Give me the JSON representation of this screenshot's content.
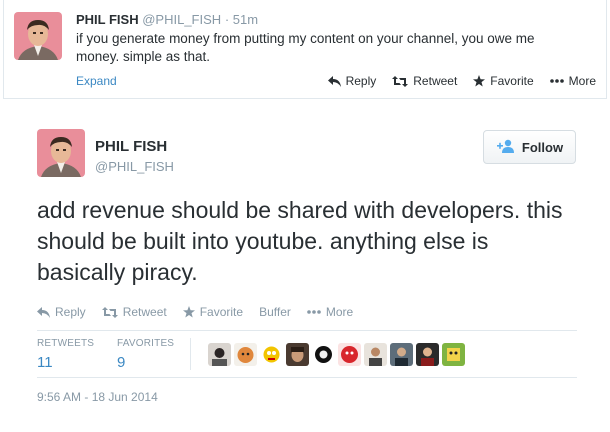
{
  "tweet_preview": {
    "name": "PHIL FISH",
    "handle": "@PHIL_FISH",
    "separator": "·",
    "time": "51m",
    "text": "if you generate money from putting my content on your channel, you owe me money. simple as that.",
    "expand_label": "Expand",
    "actions": {
      "reply": "Reply",
      "retweet": "Retweet",
      "favorite": "Favorite",
      "more": "More"
    }
  },
  "tweet_permalink": {
    "name": "PHIL FISH",
    "handle": "@PHIL_FISH",
    "follow_label": "Follow",
    "text": "add revenue should be shared with developers. this should be built into youtube. anything else is basically piracy.",
    "actions": {
      "reply": "Reply",
      "retweet": "Retweet",
      "favorite": "Favorite",
      "buffer": "Buffer",
      "more": "More"
    },
    "stats": {
      "retweets_label": "RETWEETS",
      "retweets_count": "11",
      "favorites_label": "FAVORITES",
      "favorites_count": "9"
    },
    "timestamp": "9:56 AM - 18 Jun 2014"
  },
  "colors": {
    "link_blue": "#3b88c3",
    "muted_gray": "#8899a6",
    "text_dark": "#292f33",
    "border": "#e1e8ed"
  },
  "icons": [
    "reply-icon",
    "retweet-icon",
    "favorite-star-icon",
    "more-dots-icon",
    "follow-person-icon"
  ]
}
